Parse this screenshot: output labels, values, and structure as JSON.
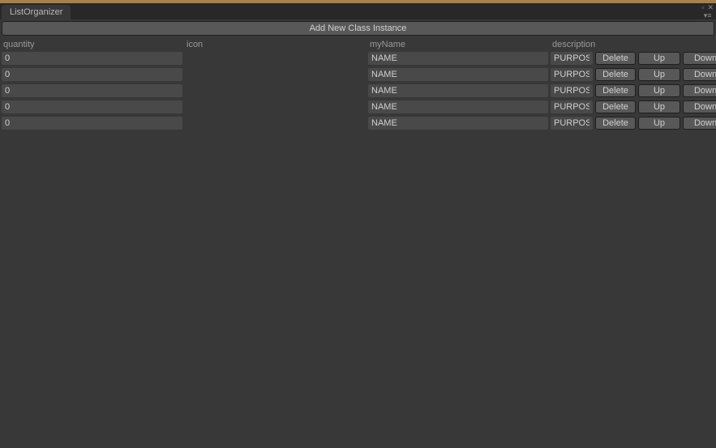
{
  "window": {
    "tab_title": "ListOrganizer"
  },
  "toolbar": {
    "add_label": "Add New Class Instance"
  },
  "headers": {
    "quantity": "quantity",
    "icon": "icon",
    "myName": "myName",
    "description": "description"
  },
  "row_buttons": {
    "delete": "Delete",
    "up": "Up",
    "down": "Down"
  },
  "rows": [
    {
      "quantity": "0",
      "myName": "NAME",
      "description": "PURPOSE"
    },
    {
      "quantity": "0",
      "myName": "NAME",
      "description": "PURPOSE"
    },
    {
      "quantity": "0",
      "myName": "NAME",
      "description": "PURPOSE"
    },
    {
      "quantity": "0",
      "myName": "NAME",
      "description": "PURPOSE"
    },
    {
      "quantity": "0",
      "myName": "NAME",
      "description": "PURPOSE"
    }
  ]
}
